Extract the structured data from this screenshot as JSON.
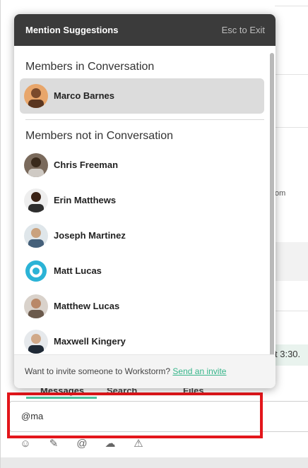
{
  "popup": {
    "title": "Mention Suggestions",
    "esc_hint": "Esc to Exit",
    "in_conversation_title": "Members in Conversation",
    "not_in_conversation_title": "Members not in Conversation",
    "in_conversation": [
      {
        "name": "Marco Barnes",
        "selected": true
      }
    ],
    "not_in_conversation": [
      {
        "name": "Chris Freeman"
      },
      {
        "name": "Erin Matthews"
      },
      {
        "name": "Joseph Martinez"
      },
      {
        "name": "Matt Lucas"
      },
      {
        "name": "Matthew Lucas"
      },
      {
        "name": "Maxwell Kingery"
      }
    ],
    "footer_text": "Want to invite someone to Workstorm? ",
    "footer_link": "Send an invite"
  },
  "background": {
    "partial_text_1": "om",
    "partial_text_2": "t 3:30.",
    "tabs": [
      "Messages",
      "Search",
      "Files"
    ]
  },
  "composer": {
    "value": "@ma"
  },
  "toolbar": {
    "icons": [
      "smiley-icon",
      "pen-icon",
      "at-icon",
      "cloud-upload-icon",
      "alert-icon"
    ]
  },
  "colors": {
    "header_bg": "#3b3b3b",
    "selected_bg": "#dcdcdc",
    "link": "#36b58a",
    "highlight": "#e3161b"
  }
}
